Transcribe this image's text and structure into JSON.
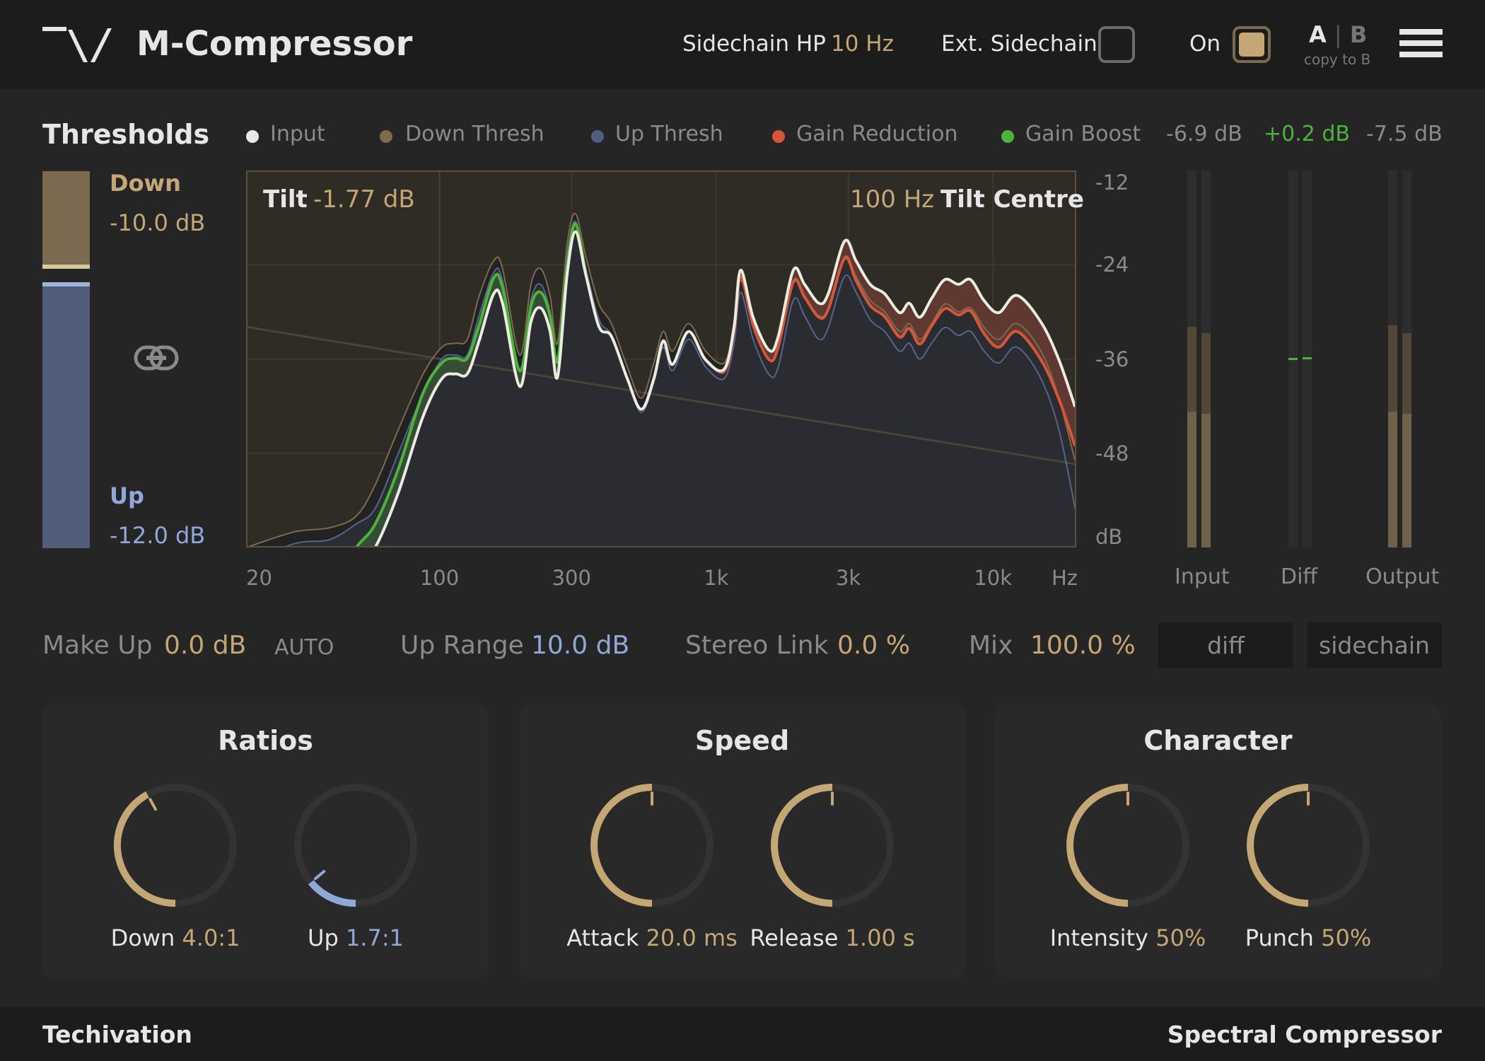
{
  "header": {
    "title": "M-Compressor",
    "sidechain_hp_label": "Sidechain HP",
    "sidechain_hp_value": "10 Hz",
    "ext_sidechain_label": "Ext. Sidechain",
    "ext_sidechain_checked": false,
    "on_label": "On",
    "on_checked": true,
    "ab_a": "A",
    "ab_sep": "|",
    "ab_b": "B",
    "copy_to_b": "copy to B"
  },
  "thresholds": {
    "title": "Thresholds",
    "down_label": "Down",
    "down_value": "-10.0 dB",
    "up_label": "Up",
    "up_value": "-12.0 dB"
  },
  "legend": [
    {
      "label": "Input",
      "color": "#e8e8e8"
    },
    {
      "label": "Down Thresh",
      "color": "#7d6a4f"
    },
    {
      "label": "Up Thresh",
      "color": "#4f5f80"
    },
    {
      "label": "Gain Reduction",
      "color": "#d4573a"
    },
    {
      "label": "Gain Boost",
      "color": "#4db33d"
    }
  ],
  "meters": {
    "input_readout": "-6.9 dB",
    "diff_readout": "+0.2 dB",
    "output_readout": "-7.5 dB",
    "input_label": "Input",
    "diff_label": "Diff",
    "output_label": "Output",
    "input_level": [
      0.36,
      0.354
    ],
    "input_peak": [
      0.585,
      0.568
    ],
    "diff_level": [
      0.497,
      0.5
    ],
    "output_level": [
      0.36,
      0.354
    ],
    "output_peak": [
      0.59,
      0.568
    ]
  },
  "chart_data": {
    "type": "line",
    "tilt_label": "Tilt",
    "tilt_value": "-1.77 dB",
    "tilt_centre_value": "100 Hz",
    "tilt_centre_label": "Tilt Centre",
    "xlim": [
      20,
      20000
    ],
    "ylim": [
      -60,
      -12
    ],
    "x_scale": "log",
    "grid": true,
    "x_ticks": [
      {
        "label": "20",
        "freq": 20
      },
      {
        "label": "100",
        "freq": 100
      },
      {
        "label": "300",
        "freq": 300
      },
      {
        "label": "1k",
        "freq": 1000
      },
      {
        "label": "3k",
        "freq": 3000
      },
      {
        "label": "10k",
        "freq": 10000
      }
    ],
    "x_unit": "Hz",
    "y_ticks": [
      {
        "label": "-12",
        "db": -12
      },
      {
        "label": "-24",
        "db": -24
      },
      {
        "label": "-36",
        "db": -36
      },
      {
        "label": "-48",
        "db": -48
      }
    ],
    "y_unit": "dB",
    "tilt_line": {
      "freqs": [
        20,
        20000
      ],
      "db": [
        -31.9,
        -49.4
      ]
    },
    "freqs": [
      20,
      30,
      40,
      50,
      58.6,
      71,
      87,
      102,
      114,
      126,
      139,
      157,
      169,
      195,
      214,
      232,
      251,
      267,
      289,
      310,
      338,
      377,
      418,
      477,
      536,
      595,
      643,
      695,
      794,
      915,
      1068,
      1160,
      1225,
      1359,
      1554,
      1677,
      1900,
      2085,
      2350,
      2540,
      2910,
      3200,
      3600,
      4060,
      4600,
      4980,
      5440,
      6000,
      6700,
      7500,
      8300,
      9300,
      10500,
      12200,
      14900,
      17300,
      19800
    ],
    "series": [
      {
        "name": "Input",
        "color": "#ecebe0",
        "db": [
          -80,
          -74,
          -68,
          -63,
          -60,
          -53,
          -43.4,
          -38.5,
          -37.9,
          -37.9,
          -33.7,
          -27.7,
          -28.9,
          -39.5,
          -31.3,
          -29.5,
          -32.5,
          -38.3,
          -25.3,
          -19.8,
          -25.3,
          -31.9,
          -33.1,
          -38.5,
          -42.4,
          -38.5,
          -33.7,
          -36.7,
          -32.5,
          -36.1,
          -37.3,
          -31.9,
          -24.7,
          -30.7,
          -34.9,
          -33.1,
          -24.7,
          -26.5,
          -28.9,
          -27.7,
          -21.0,
          -23.5,
          -26.5,
          -27.7,
          -30.1,
          -28.9,
          -30.7,
          -28.3,
          -25.9,
          -26.5,
          -25.9,
          -28.6,
          -30.1,
          -27.9,
          -31.3,
          -36.1,
          -42.1
        ]
      },
      {
        "name": "Down Thresh",
        "color": "#7d6a4f",
        "db": [
          -60,
          -58,
          -57.5,
          -56,
          -52,
          -45,
          -38,
          -34.5,
          -34,
          -33.5,
          -28,
          -23.5,
          -24.5,
          -35.5,
          -26.5,
          -24.5,
          -28,
          -34,
          -21.5,
          -17.5,
          -23,
          -29,
          -31.5,
          -37,
          -41,
          -36.5,
          -32.5,
          -35,
          -31.5,
          -35,
          -36.5,
          -32,
          -26,
          -31.5,
          -36,
          -34.5,
          -26,
          -28,
          -30.5,
          -29.5,
          -23,
          -25.5,
          -28.5,
          -30,
          -32.5,
          -31.5,
          -33.5,
          -31.5,
          -29,
          -30,
          -29.5,
          -32,
          -33.5,
          -31.5,
          -35,
          -41,
          -49
        ]
      },
      {
        "name": "Up Thresh",
        "color": "#55658a",
        "db": [
          -62,
          -59.5,
          -59,
          -57,
          -55,
          -48,
          -40.5,
          -36,
          -35.5,
          -35.5,
          -30.5,
          -25,
          -26,
          -37.5,
          -28.5,
          -26.5,
          -30,
          -36,
          -23,
          -18.5,
          -24.5,
          -31,
          -33,
          -38.5,
          -42.8,
          -39,
          -34.5,
          -37.5,
          -33.5,
          -37,
          -38.5,
          -34,
          -27.5,
          -33.5,
          -38,
          -37,
          -28.5,
          -30.5,
          -33.5,
          -32,
          -25.5,
          -27.5,
          -31,
          -32.5,
          -35,
          -34,
          -36,
          -34,
          -32,
          -33,
          -32.5,
          -35,
          -36.5,
          -34.5,
          -38.5,
          -45,
          -55
        ]
      },
      {
        "name": "Gain",
        "gain_db": [
          3,
          3,
          3,
          3,
          3,
          3,
          3,
          2,
          2,
          2,
          2,
          2,
          2,
          2,
          2,
          2,
          2,
          2,
          1,
          1,
          0,
          0,
          0,
          0,
          0,
          0,
          0,
          0,
          0,
          0,
          -0.3,
          -0.5,
          -0.8,
          -1,
          -1.2,
          -1.3,
          -1.5,
          -1.6,
          -1.8,
          -2,
          -2.2,
          -2.5,
          -2.7,
          -2.9,
          -3.1,
          -3.2,
          -3.4,
          -3.5,
          -3.7,
          -3.9,
          -4,
          -4.2,
          -4.4,
          -4.6,
          -4.8,
          -5,
          -5
        ]
      }
    ]
  },
  "controls": {
    "makeup_label": "Make Up",
    "makeup_value": "0.0 dB",
    "auto_label": "AUTO",
    "uprange_label": "Up Range",
    "uprange_value": "10.0 dB",
    "stereolink_label": "Stereo Link",
    "stereolink_value": "0.0 %",
    "mix_label": "Mix",
    "mix_value": "100.0 %",
    "diff_button": "diff",
    "sidechain_button": "sidechain"
  },
  "panels": [
    {
      "title": "Ratios",
      "knobs": [
        {
          "label": "Down",
          "value": "4.0:1",
          "fill": 0.42,
          "color": "#c4a774"
        },
        {
          "label": "Up",
          "value": "1.7:1",
          "fill": 0.14,
          "color": "#8fa8d8"
        }
      ]
    },
    {
      "title": "Speed",
      "knobs": [
        {
          "label": "Attack",
          "value": "20.0 ms",
          "fill": 0.5,
          "color": "#c4a774"
        },
        {
          "label": "Release",
          "value": "1.00 s",
          "fill": 0.5,
          "color": "#c4a774"
        }
      ]
    },
    {
      "title": "Character",
      "knobs": [
        {
          "label": "Intensity",
          "value": "50%",
          "fill": 0.5,
          "color": "#c4a774"
        },
        {
          "label": "Punch",
          "value": "50%",
          "fill": 0.5,
          "color": "#c4a774"
        }
      ]
    }
  ],
  "footer": {
    "brand": "Techivation",
    "product": "Spectral Compressor"
  }
}
